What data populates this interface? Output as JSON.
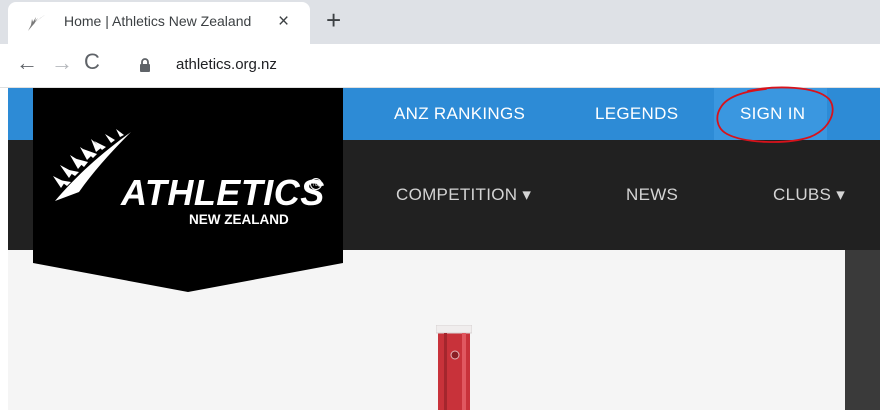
{
  "browser": {
    "tab_title": "Home | Athletics New Zealand",
    "tab_close": "×",
    "new_tab": "+",
    "back": "←",
    "forward": "→",
    "reload": "C",
    "url": "athletics.org.nz"
  },
  "site": {
    "logo": {
      "main": "ATHLETICS",
      "sub": "NEW ZEALAND",
      "tm": "TM"
    },
    "top_nav": [
      {
        "label": "ANZ RANKINGS"
      },
      {
        "label": "LEGENDS"
      },
      {
        "label": "SIGN IN"
      }
    ],
    "main_nav": [
      {
        "label": "COMPETITION ▾"
      },
      {
        "label": "NEWS"
      },
      {
        "label": "CLUBS ▾"
      }
    ]
  },
  "colors": {
    "top_bar": "#2d8bd6",
    "main_bar": "#212121",
    "logo_bg": "#000000",
    "annotation": "#d8121b"
  },
  "annotation": {
    "target": "sign-in-link",
    "shape": "hand-drawn-circle"
  }
}
